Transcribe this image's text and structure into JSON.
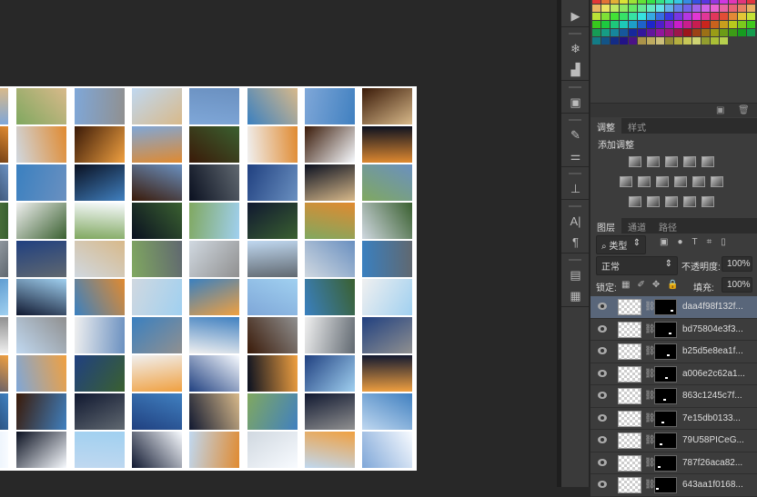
{
  "toolbar_icons": [
    "play-icon",
    "snowflake-icon",
    "histogram-icon",
    "cube-icon",
    "brushes-icon",
    "sliders-icon",
    "stamp-icon",
    "character-icon",
    "paragraph-icon",
    "doc-icon",
    "notes-icon"
  ],
  "adjustments": {
    "tabs": [
      "调整",
      "样式"
    ],
    "title": "添加调整"
  },
  "layers_panel": {
    "tabs": [
      "图层",
      "通道",
      "路径"
    ],
    "filter_label": "类型",
    "blend_mode": "正常",
    "opacity_label": "不透明度:",
    "opacity_value": "100%",
    "lock_label": "锁定:",
    "fill_label": "填充:",
    "fill_value": "100%",
    "layers": [
      {
        "name": "daa4f98f132f..."
      },
      {
        "name": "bd75804e3f3..."
      },
      {
        "name": "b25d5e8ea1f..."
      },
      {
        "name": "a006e2c62a1..."
      },
      {
        "name": "863c1245c7f..."
      },
      {
        "name": "7e15db0133..."
      },
      {
        "name": "79U58PICeG..."
      },
      {
        "name": "787f26aca82..."
      },
      {
        "name": "643aa1f0168..."
      }
    ]
  }
}
